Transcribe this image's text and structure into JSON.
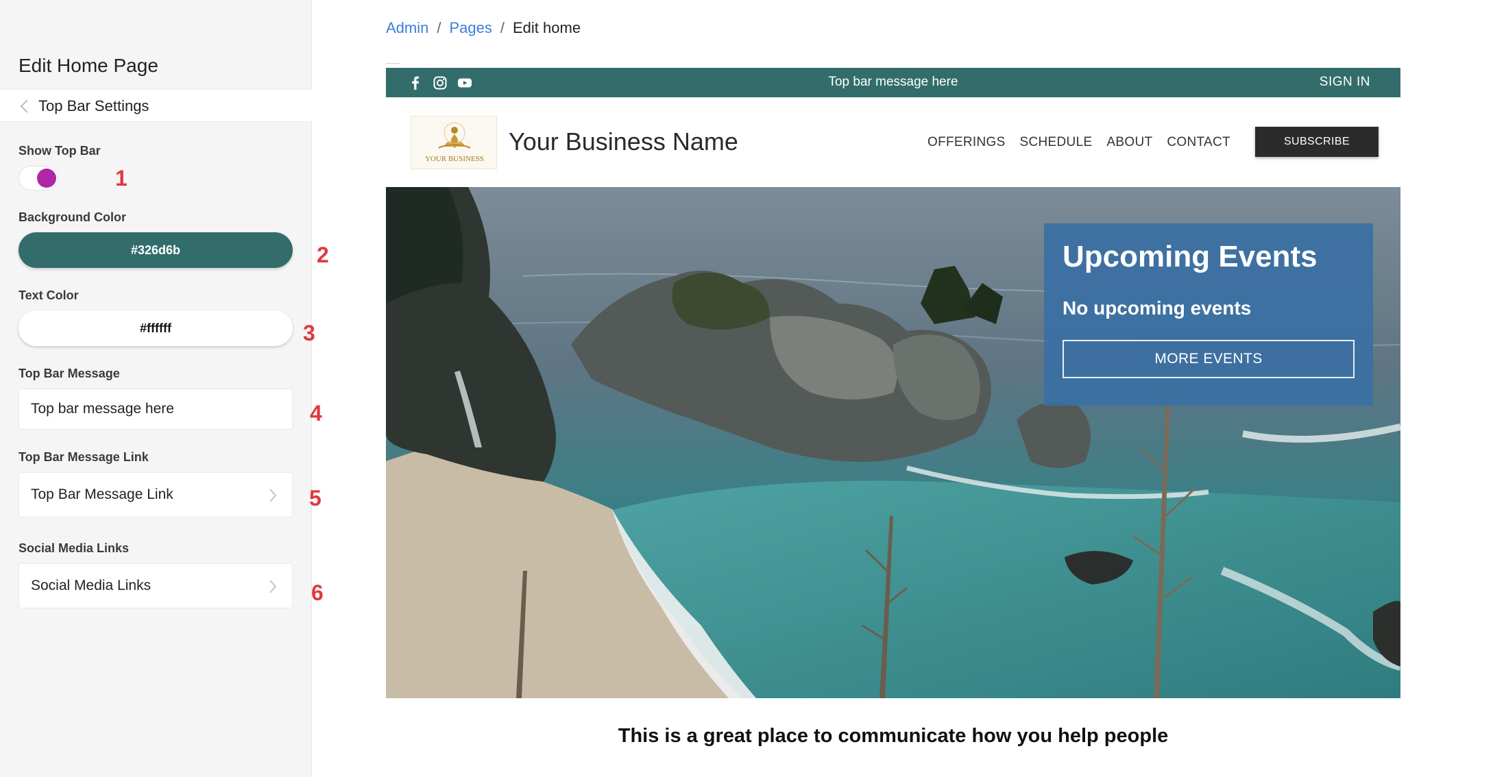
{
  "sidebar": {
    "title": "Edit Home Page",
    "back_label": "Top Bar Settings",
    "show_top_bar": {
      "label": "Show Top Bar",
      "enabled": true,
      "knob_color": "#b026a8"
    },
    "background_color": {
      "label": "Background Color",
      "value": "#326d6b"
    },
    "text_color": {
      "label": "Text Color",
      "value": "#ffffff"
    },
    "top_bar_message": {
      "label": "Top Bar Message",
      "value": "Top bar message here"
    },
    "top_bar_message_link": {
      "label": "Top Bar Message Link",
      "button_label": "Top Bar Message Link"
    },
    "social_media_links": {
      "label": "Social Media Links",
      "button_label": "Social Media Links"
    }
  },
  "markers": [
    "1",
    "2",
    "3",
    "4",
    "5",
    "6"
  ],
  "breadcrumb": {
    "admin": "Admin",
    "pages": "Pages",
    "current": "Edit home",
    "separator": "/"
  },
  "preview": {
    "topbar": {
      "message": "Top bar message here",
      "sign_in": "SIGN IN",
      "icons": [
        "facebook-icon",
        "instagram-icon",
        "youtube-icon"
      ]
    },
    "header": {
      "logo_text": "YOUR BUSINESS",
      "business_name": "Your Business Name",
      "nav": [
        "OFFERINGS",
        "SCHEDULE",
        "ABOUT",
        "CONTACT"
      ],
      "subscribe": "SUBSCRIBE"
    },
    "events": {
      "heading": "Upcoming Events",
      "empty": "No upcoming events",
      "button": "MORE EVENTS",
      "bg_color": "#3a70a3"
    },
    "tagline": "This is a great place to communicate how you help people"
  },
  "colors": {
    "link": "#3b7ddd",
    "marker": "#e0393e",
    "subscribe_bg": "#2b2b2b"
  }
}
